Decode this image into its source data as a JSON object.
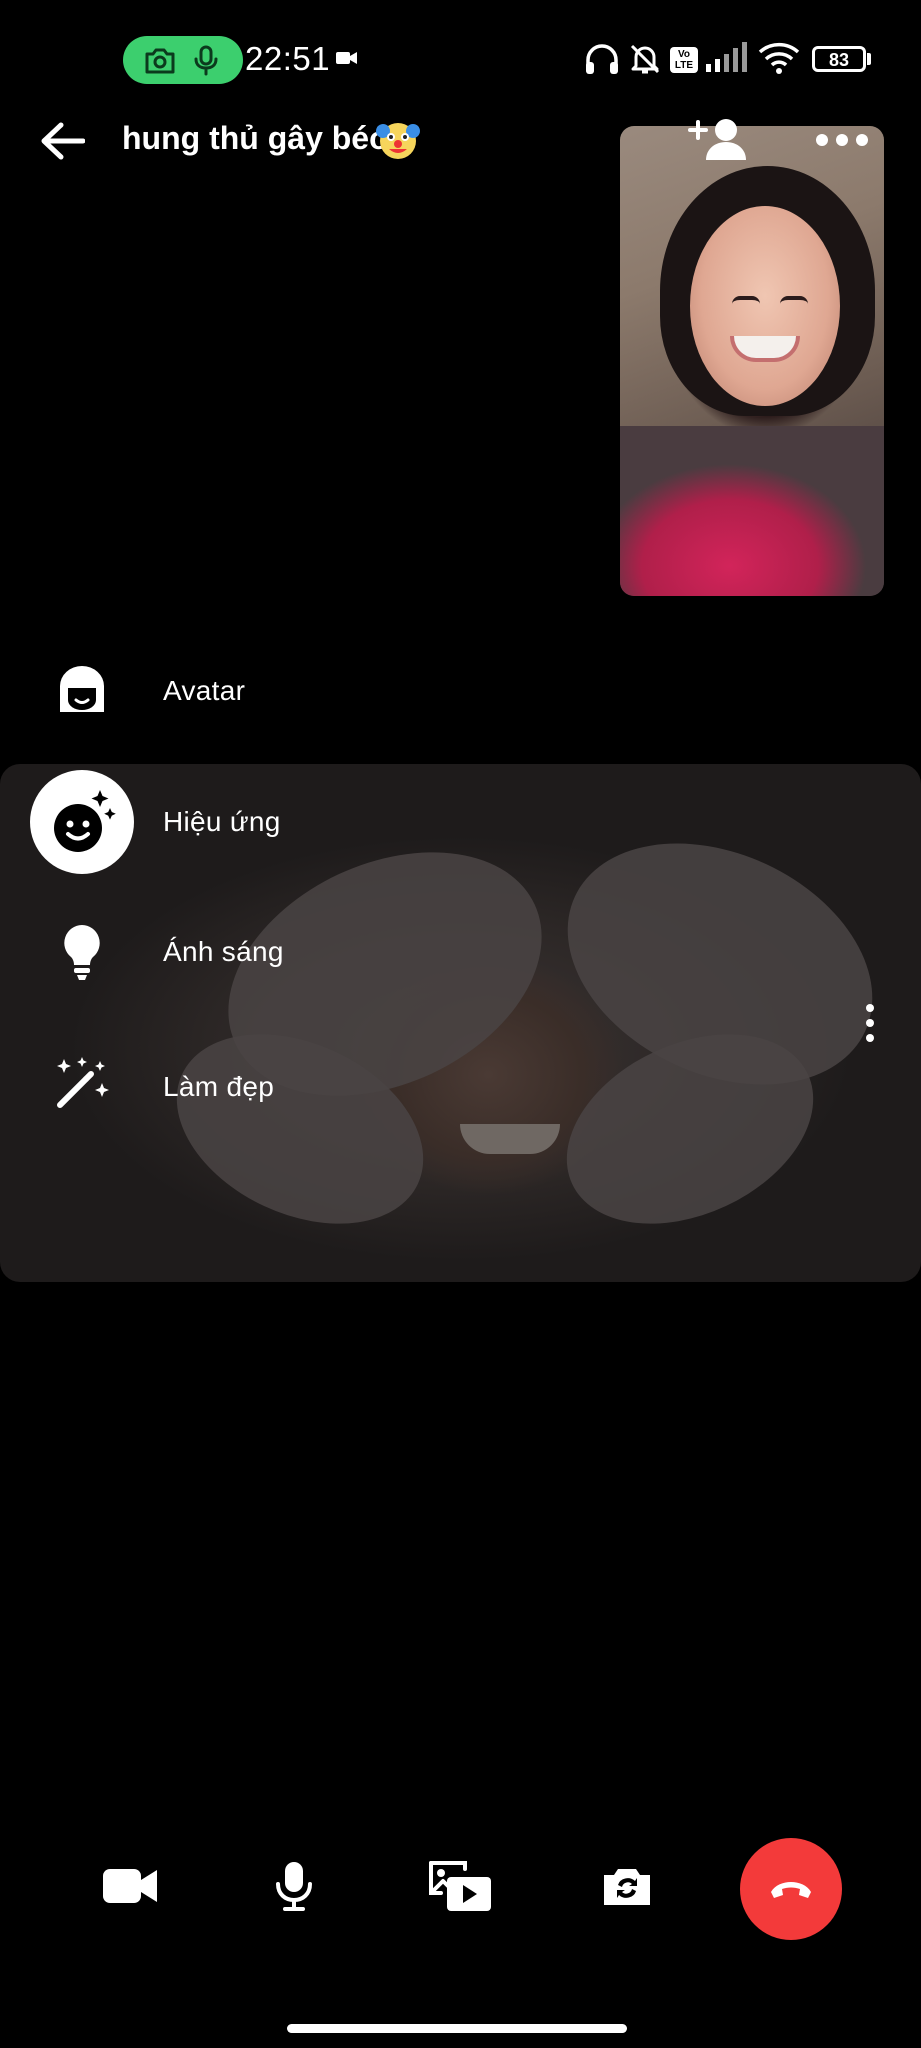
{
  "status_bar": {
    "time": "22:51",
    "battery": "83",
    "volte": "Vo LTE"
  },
  "header": {
    "title": "hung thủ gây béo",
    "title_emoji": "clown-face-icon"
  },
  "effects_menu": {
    "items": [
      {
        "label": "Avatar",
        "icon": "avatar-icon",
        "selected": false
      },
      {
        "label": "Hiệu ứng",
        "icon": "effects-smiley-icon",
        "selected": true
      },
      {
        "label": "Ánh sáng",
        "icon": "lightbulb-icon",
        "selected": false
      },
      {
        "label": "Làm đẹp",
        "icon": "magic-wand-icon",
        "selected": false
      }
    ]
  },
  "controls": {
    "buttons": [
      "video-camera-icon",
      "microphone-icon",
      "media-share-icon",
      "flip-camera-icon",
      "end-call-icon"
    ],
    "end_call_color": "#f33a3a"
  },
  "colors": {
    "background": "#000000",
    "recording_pill": "#3ccf6e",
    "end_call": "#f33a3a",
    "text": "#ffffff"
  }
}
